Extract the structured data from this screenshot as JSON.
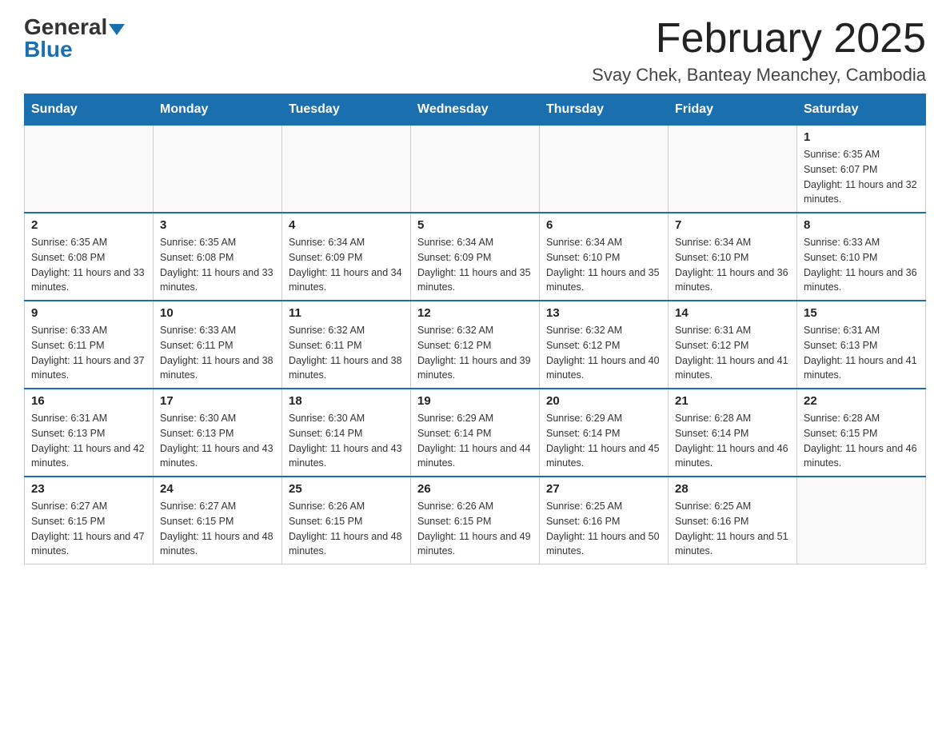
{
  "logo": {
    "general": "General",
    "blue": "Blue"
  },
  "title": "February 2025",
  "location": "Svay Chek, Banteay Meanchey, Cambodia",
  "days_of_week": [
    "Sunday",
    "Monday",
    "Tuesday",
    "Wednesday",
    "Thursday",
    "Friday",
    "Saturday"
  ],
  "weeks": [
    [
      {
        "day": "",
        "info": ""
      },
      {
        "day": "",
        "info": ""
      },
      {
        "day": "",
        "info": ""
      },
      {
        "day": "",
        "info": ""
      },
      {
        "day": "",
        "info": ""
      },
      {
        "day": "",
        "info": ""
      },
      {
        "day": "1",
        "info": "Sunrise: 6:35 AM\nSunset: 6:07 PM\nDaylight: 11 hours and 32 minutes."
      }
    ],
    [
      {
        "day": "2",
        "info": "Sunrise: 6:35 AM\nSunset: 6:08 PM\nDaylight: 11 hours and 33 minutes."
      },
      {
        "day": "3",
        "info": "Sunrise: 6:35 AM\nSunset: 6:08 PM\nDaylight: 11 hours and 33 minutes."
      },
      {
        "day": "4",
        "info": "Sunrise: 6:34 AM\nSunset: 6:09 PM\nDaylight: 11 hours and 34 minutes."
      },
      {
        "day": "5",
        "info": "Sunrise: 6:34 AM\nSunset: 6:09 PM\nDaylight: 11 hours and 35 minutes."
      },
      {
        "day": "6",
        "info": "Sunrise: 6:34 AM\nSunset: 6:10 PM\nDaylight: 11 hours and 35 minutes."
      },
      {
        "day": "7",
        "info": "Sunrise: 6:34 AM\nSunset: 6:10 PM\nDaylight: 11 hours and 36 minutes."
      },
      {
        "day": "8",
        "info": "Sunrise: 6:33 AM\nSunset: 6:10 PM\nDaylight: 11 hours and 36 minutes."
      }
    ],
    [
      {
        "day": "9",
        "info": "Sunrise: 6:33 AM\nSunset: 6:11 PM\nDaylight: 11 hours and 37 minutes."
      },
      {
        "day": "10",
        "info": "Sunrise: 6:33 AM\nSunset: 6:11 PM\nDaylight: 11 hours and 38 minutes."
      },
      {
        "day": "11",
        "info": "Sunrise: 6:32 AM\nSunset: 6:11 PM\nDaylight: 11 hours and 38 minutes."
      },
      {
        "day": "12",
        "info": "Sunrise: 6:32 AM\nSunset: 6:12 PM\nDaylight: 11 hours and 39 minutes."
      },
      {
        "day": "13",
        "info": "Sunrise: 6:32 AM\nSunset: 6:12 PM\nDaylight: 11 hours and 40 minutes."
      },
      {
        "day": "14",
        "info": "Sunrise: 6:31 AM\nSunset: 6:12 PM\nDaylight: 11 hours and 41 minutes."
      },
      {
        "day": "15",
        "info": "Sunrise: 6:31 AM\nSunset: 6:13 PM\nDaylight: 11 hours and 41 minutes."
      }
    ],
    [
      {
        "day": "16",
        "info": "Sunrise: 6:31 AM\nSunset: 6:13 PM\nDaylight: 11 hours and 42 minutes."
      },
      {
        "day": "17",
        "info": "Sunrise: 6:30 AM\nSunset: 6:13 PM\nDaylight: 11 hours and 43 minutes."
      },
      {
        "day": "18",
        "info": "Sunrise: 6:30 AM\nSunset: 6:14 PM\nDaylight: 11 hours and 43 minutes."
      },
      {
        "day": "19",
        "info": "Sunrise: 6:29 AM\nSunset: 6:14 PM\nDaylight: 11 hours and 44 minutes."
      },
      {
        "day": "20",
        "info": "Sunrise: 6:29 AM\nSunset: 6:14 PM\nDaylight: 11 hours and 45 minutes."
      },
      {
        "day": "21",
        "info": "Sunrise: 6:28 AM\nSunset: 6:14 PM\nDaylight: 11 hours and 46 minutes."
      },
      {
        "day": "22",
        "info": "Sunrise: 6:28 AM\nSunset: 6:15 PM\nDaylight: 11 hours and 46 minutes."
      }
    ],
    [
      {
        "day": "23",
        "info": "Sunrise: 6:27 AM\nSunset: 6:15 PM\nDaylight: 11 hours and 47 minutes."
      },
      {
        "day": "24",
        "info": "Sunrise: 6:27 AM\nSunset: 6:15 PM\nDaylight: 11 hours and 48 minutes."
      },
      {
        "day": "25",
        "info": "Sunrise: 6:26 AM\nSunset: 6:15 PM\nDaylight: 11 hours and 48 minutes."
      },
      {
        "day": "26",
        "info": "Sunrise: 6:26 AM\nSunset: 6:15 PM\nDaylight: 11 hours and 49 minutes."
      },
      {
        "day": "27",
        "info": "Sunrise: 6:25 AM\nSunset: 6:16 PM\nDaylight: 11 hours and 50 minutes."
      },
      {
        "day": "28",
        "info": "Sunrise: 6:25 AM\nSunset: 6:16 PM\nDaylight: 11 hours and 51 minutes."
      },
      {
        "day": "",
        "info": ""
      }
    ]
  ]
}
